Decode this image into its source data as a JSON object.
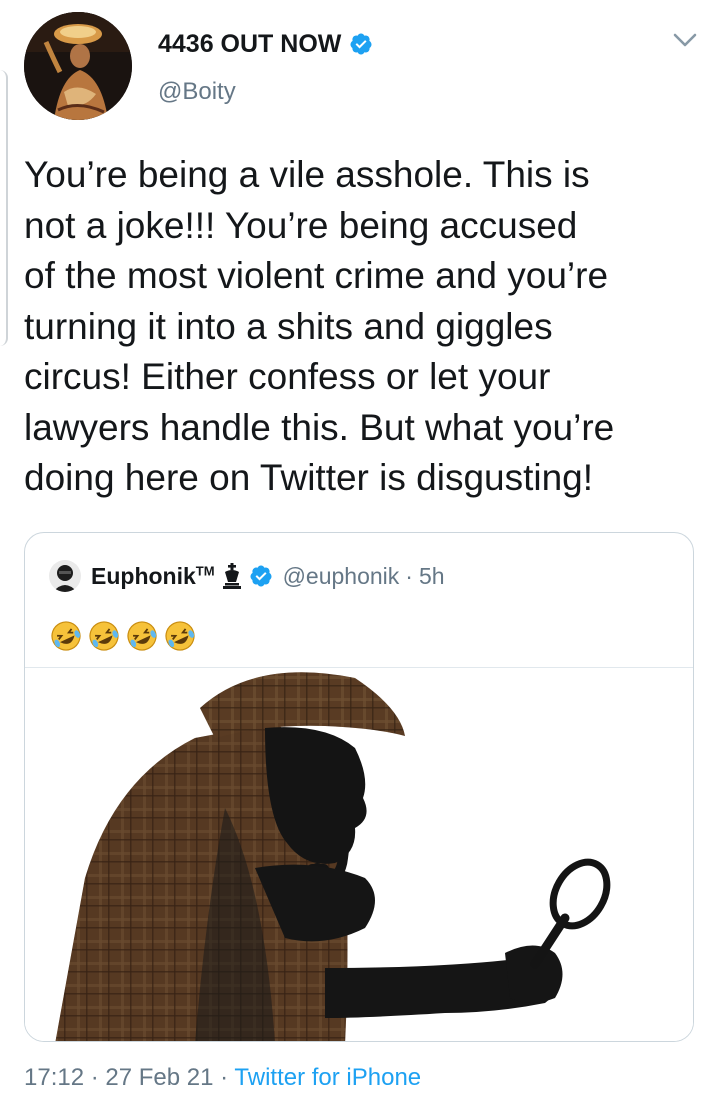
{
  "tweet": {
    "author_name": "4436 OUT NOW",
    "handle": "@Boity",
    "text": "You’re being a vile asshole. This is\nnot a joke!!! You’re being accused\nof the most violent crime and you’re\nturning it into a shits and giggles\ncircus! Either confess or let your\nlawyers handle this. But what you’re\ndoing here on Twitter is disgusting!",
    "time": "17:12",
    "separator": "·",
    "date": "27 Feb 21",
    "source": "Twitter for iPhone",
    "verified": true
  },
  "quoted_tweet": {
    "author_name": "Euphonik",
    "tm_mark": "TM",
    "handle": "@euphonik",
    "separator": "·",
    "age": "5h",
    "emojis": [
      "rolling-on-floor-laughing",
      "rolling-on-floor-laughing",
      "rolling-on-floor-laughing",
      "rolling-on-floor-laughing"
    ],
    "verified": true,
    "image_subject": "detective silhouette with deerstalker hat, pipe and magnifying glass"
  },
  "colors": {
    "text_primary": "#14171a",
    "text_secondary": "#657786",
    "link": "#1da1f2",
    "verified_blue": "#1da1f2",
    "card_border": "#ccd6dd"
  },
  "icons": {
    "verified": "verified-badge-icon",
    "caret": "chevron-down-icon",
    "chess_king": "chess-king-icon",
    "emoji": "laughing-emoji-icon"
  }
}
